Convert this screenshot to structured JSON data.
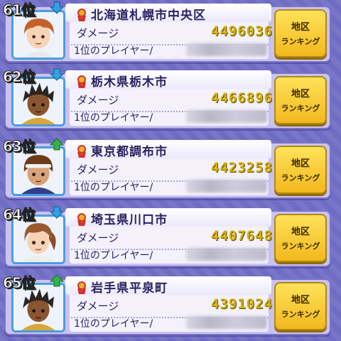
{
  "damage_label": "ダメージ",
  "top_player_label": "1位のプレイヤー/",
  "button_line1": "地区",
  "button_line2": "ランキング",
  "entries": [
    {
      "rank": "61位",
      "trend": "down",
      "city": "北海道札幌市中央区",
      "damage": "4496036",
      "avatar": "brown-hair-boy"
    },
    {
      "rank": "62位",
      "trend": "down",
      "city": "栃木県栃木市",
      "damage": "4466896",
      "avatar": "spiky-dark-hair-boy"
    },
    {
      "rank": "63位",
      "trend": "up",
      "city": "東京都調布市",
      "damage": "4423258",
      "avatar": "headband-boy"
    },
    {
      "rank": "64位",
      "trend": "down",
      "city": "埼玉県川口市",
      "damage": "4407648",
      "avatar": "ponytail-girl"
    },
    {
      "rank": "65位",
      "trend": "up",
      "city": "岩手県平泉町",
      "damage": "4391024",
      "avatar": "spiky-dark-hair-boy"
    }
  ],
  "colors": {
    "up_arrow": "#33b24a",
    "down_arrow": "#2fa3e6",
    "damage_value": "#d6b10c"
  }
}
